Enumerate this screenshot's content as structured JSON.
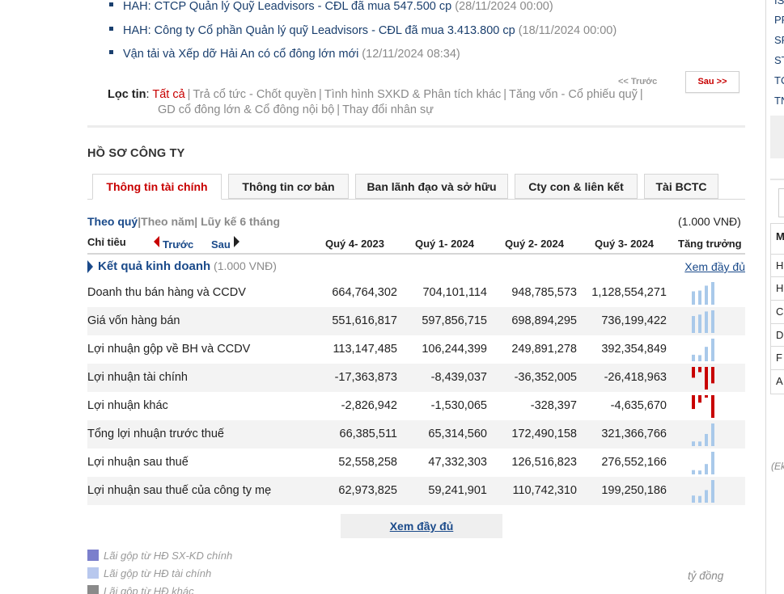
{
  "news": [
    {
      "title": "HAH: CTCP Quản lý Quỹ Leadvisors - CĐL đã mua 547.500 cp",
      "date": "(28/11/2024 00:00)"
    },
    {
      "title": "HAH: Công ty Cổ phần Quản lý quỹ Leadvisors - CĐL đã mua 3.413.800 cp",
      "date": "(18/11/2024 00:00)"
    },
    {
      "title": "Vận tải và Xếp dỡ Hải An có cổ đông lớn mới",
      "date": "(12/11/2024 08:34)"
    }
  ],
  "pager": {
    "prev": "<< Trước",
    "next": "Sau >>"
  },
  "filter": {
    "label": "Lọc tin",
    "colon": ":",
    "active": "Tất cả",
    "items": [
      "Trả cổ tức - Chốt quyền",
      "Tình hình SXKD & Phân tích khác",
      "Tăng vốn - Cổ phiếu quỹ",
      "GD cổ đông lớn & Cổ đông nội bộ",
      "Thay đổi nhân sự"
    ]
  },
  "section_title": "HỒ SƠ CÔNG TY",
  "tabs": [
    "Thông tin tài chính",
    "Thông tin cơ bản",
    "Ban lãnh đạo và sở hữu",
    "Cty con & liên kết",
    "Tài BCTC"
  ],
  "period": {
    "quarter": "Theo quý",
    "sep1": "|",
    "year": "Theo năm",
    "sep2": "|",
    "cumulative": " Lũy kế 6 tháng"
  },
  "unit": "(1.000 VNĐ)",
  "header": {
    "indicator": "Chỉ tiêu",
    "prev": "Trước",
    "next": "Sau",
    "quarters": [
      "Quý 4- 2023",
      "Quý 1- 2024",
      "Quý 2- 2024",
      "Quý 3- 2024"
    ],
    "growth": "Tăng trưởng"
  },
  "group": {
    "name": "Kết quả kinh doanh",
    "unit": " (1.000 VNĐ)",
    "more": "Xem đầy đủ"
  },
  "rows": [
    {
      "label": "Doanh thu bán hàng và CCDV",
      "values": [
        "664,764,302",
        "704,101,114",
        "948,785,573",
        "1,128,554,271"
      ]
    },
    {
      "label": "Giá vốn hàng bán",
      "values": [
        "551,616,817",
        "597,856,715",
        "698,894,295",
        "736,199,422"
      ]
    },
    {
      "label": "Lợi nhuận gộp về BH và CCDV",
      "values": [
        "113,147,485",
        "106,244,399",
        "249,891,278",
        "392,354,849"
      ]
    },
    {
      "label": "Lợi nhuận tài chính",
      "values": [
        "-17,363,873",
        "-8,439,037",
        "-36,352,005",
        "-26,418,963"
      ]
    },
    {
      "label": "Lợi nhuận khác",
      "values": [
        "-2,826,942",
        "-1,530,065",
        "-328,397",
        "-4,635,670"
      ]
    },
    {
      "label": "Tổng lợi nhuận trước thuế",
      "values": [
        "66,385,511",
        "65,314,560",
        "172,490,158",
        "321,366,766"
      ]
    },
    {
      "label": "Lợi nhuận sau thuế",
      "values": [
        "52,558,258",
        "47,332,303",
        "126,516,823",
        "276,552,166"
      ]
    },
    {
      "label": "Lợi nhuận sau thuế của công ty mẹ",
      "values": [
        "62,973,825",
        "59,241,901",
        "110,742,310",
        "199,250,186"
      ]
    }
  ],
  "more_button": "Xem đầy đủ",
  "legend": [
    {
      "label": "Lãi gộp từ HĐ SX-KD chính",
      "color": "#7b7fcc"
    },
    {
      "label": "Lãi gộp từ HĐ tài chính",
      "color": "#b8c8ee"
    },
    {
      "label": "Lãi gộp từ HĐ khác",
      "color": "#8a8a8a"
    }
  ],
  "chart_unit": "tỷ đồng",
  "colors": {
    "positive": "#a9c9ea",
    "negative": "#c80000",
    "accent": "#c80000",
    "link": "#1a4a8a"
  },
  "sidebar": {
    "items": [
      "IS",
      "PF",
      "SF",
      "ST",
      "TC",
      "TN"
    ],
    "cells": [
      "M",
      "H",
      "H",
      "C",
      "D",
      "F",
      "A"
    ],
    "note": "(Ek"
  }
}
